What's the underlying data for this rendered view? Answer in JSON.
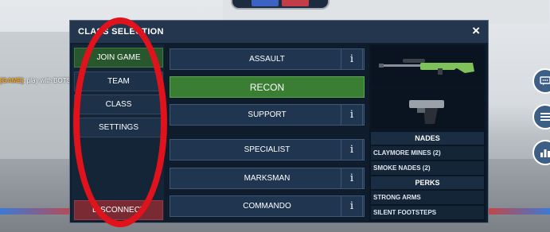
{
  "chat": {
    "tag": "[GAME]",
    "message": ": play with BOTS"
  },
  "dialog": {
    "title": "CLASS SELECTION",
    "close_label": "×"
  },
  "nav": {
    "join_game": "JOIN GAME",
    "team": "TEAM",
    "class": "CLASS",
    "settings": "SETTINGS",
    "disconnect": "DISCONNECT"
  },
  "classes": [
    {
      "label": "ASSAULT",
      "info": "i"
    },
    {
      "label": "RECON"
    },
    {
      "label": "SUPPORT",
      "info": "i"
    },
    {
      "label": "SPECIALIST",
      "info": "i"
    },
    {
      "label": "MARKSMAN",
      "info": "i"
    },
    {
      "label": "COMMANDO",
      "info": "i"
    }
  ],
  "loadout": {
    "nades_header": "NADES",
    "nades": [
      "CLAYMORE MINES (2)",
      "SMOKE NADES (2)"
    ],
    "perks_header": "PERKS",
    "perks": [
      "STRONG ARMS",
      "SILENT FOOTSTEPS"
    ]
  },
  "side_buttons": [
    "chat-icon",
    "menu-icon",
    "stats-icon"
  ],
  "colors": {
    "active_green": "#3a7e34",
    "disconnect_red": "#7a2a33",
    "annotation_red": "#e0121b"
  }
}
